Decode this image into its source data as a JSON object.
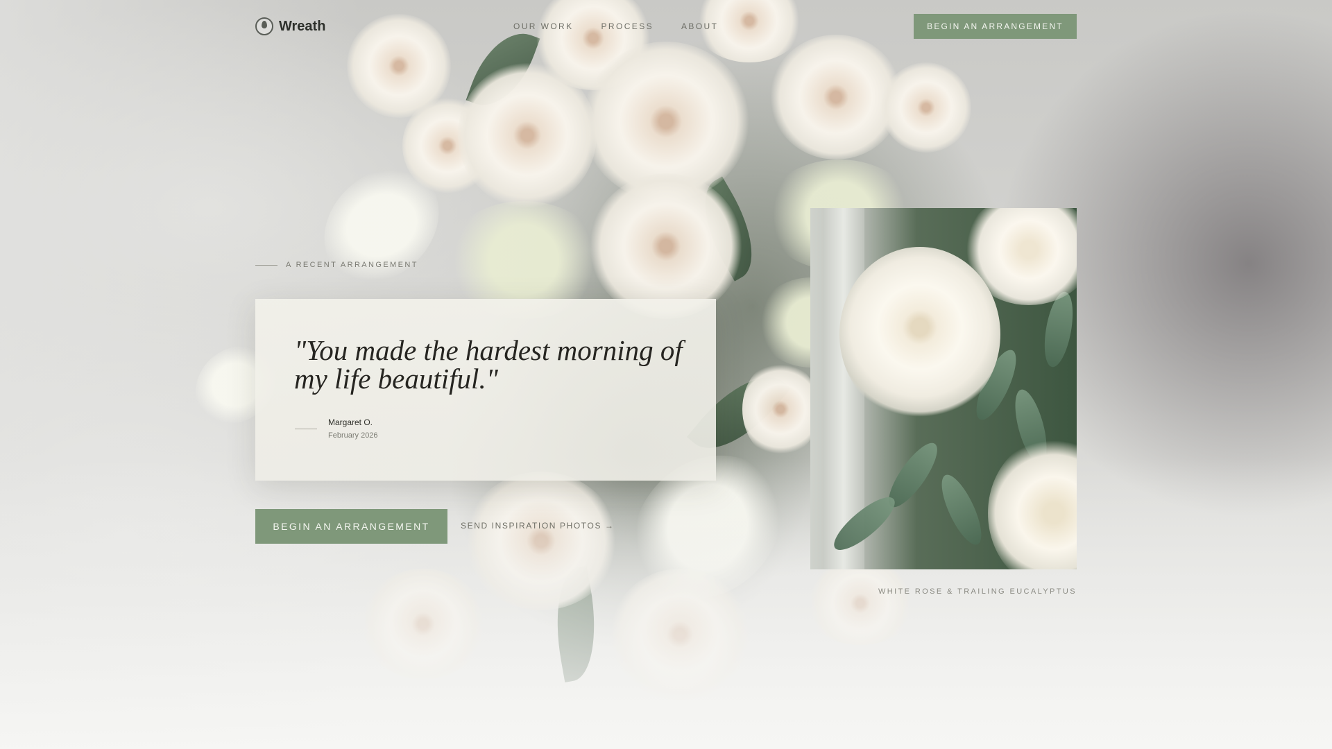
{
  "header": {
    "brand_name": "Wreath",
    "nav": [
      "Our Work",
      "Process",
      "About"
    ],
    "cta_label": "Begin an Arrangement"
  },
  "hero": {
    "eyebrow": "A Recent Arrangement",
    "testimonial": {
      "quote": "\"You made the hardest morning of my life beautiful.\"",
      "author": "Margaret O.",
      "date": "February 2026"
    },
    "primary_cta": "Begin an Arrangement",
    "secondary_link": "Send inspiration photos →"
  },
  "feature": {
    "caption": "White Rose & Trailing Eucalyptus"
  },
  "colors": {
    "accent": "#7f987a",
    "text": "#2b2b27",
    "muted": "#7a7a72",
    "card": "#f0efe8"
  },
  "icons": {
    "brand": "wreath-logo-icon"
  }
}
